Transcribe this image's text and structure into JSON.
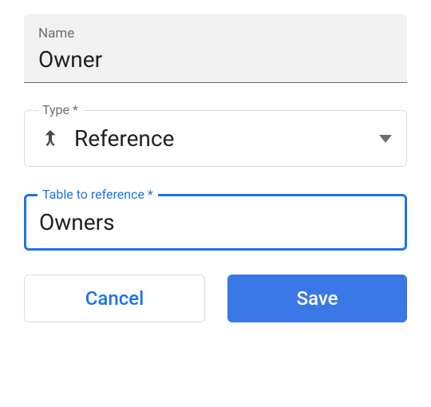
{
  "name_field": {
    "label": "Name",
    "value": "Owner"
  },
  "type_field": {
    "label": "Type *",
    "value": "Reference",
    "icon": "merge-icon"
  },
  "reference_field": {
    "label": "Table to reference *",
    "value": "Owners"
  },
  "buttons": {
    "cancel": "Cancel",
    "save": "Save"
  }
}
